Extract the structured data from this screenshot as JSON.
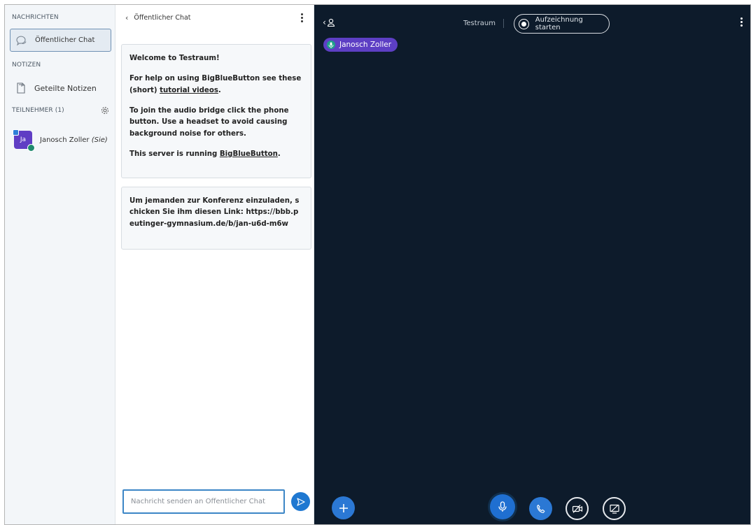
{
  "sidebar": {
    "messages_title": "NACHRICHTEN",
    "public_chat_label": "Öffentlicher Chat",
    "notes_title": "NOTIZEN",
    "shared_notes_label": "Geteilte Notizen",
    "participants_title": "TEILNEHMER (1)",
    "user": {
      "initials": "Ja",
      "name": "Janosch Zoller",
      "you_suffix": "(Sie)"
    }
  },
  "chat": {
    "title": "Öffentlicher Chat",
    "welcome": {
      "line1_prefix": "Welcome to ",
      "line1_room": "Testraum",
      "line1_suffix": "!",
      "help_text": "For help on using BigBlueButton see these (short) ",
      "help_link": "tutorial videos",
      "help_end": ".",
      "audio_text": "To join the audio bridge click the phone button. Use a headset to avoid causing background noise for others.",
      "server_text": "This server is running ",
      "server_link": "BigBlueButton",
      "server_end": "."
    },
    "invite": {
      "text": "Um jemanden zur Konferenz einzuladen, schicken Sie ihm diesen Link:",
      "link": "https://bbb.peutinger-gymnasium.de/b/jan-u6d-m6w"
    },
    "input_placeholder": "Nachricht senden an Öffentlicher Chat"
  },
  "stage": {
    "room_name": "Testraum",
    "record_label": "Aufzeichnung starten",
    "talking_user": "Janosch Zoller",
    "colors": {
      "background": "#0d1b2b",
      "primary": "#2b78d4",
      "talker": "#5d3fc4"
    }
  }
}
